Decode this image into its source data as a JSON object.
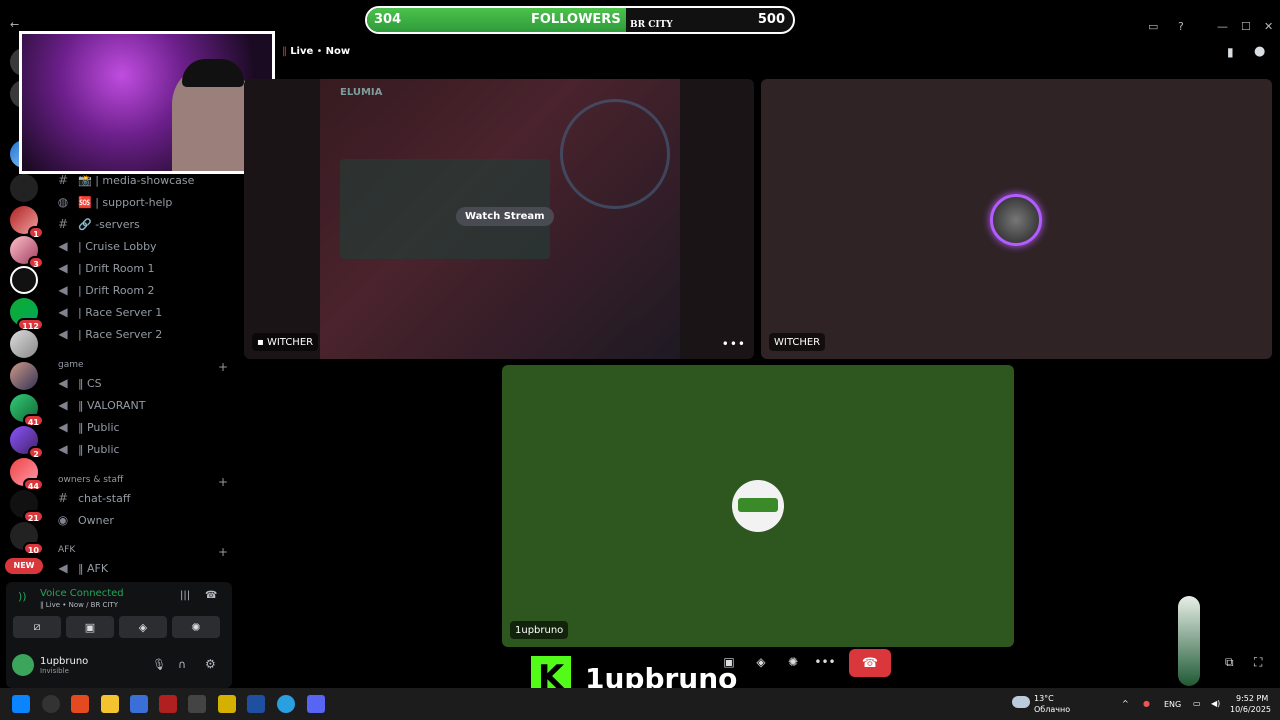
{
  "overlay": {
    "followers_current": "304",
    "followers_label": "FOLLOWERS",
    "followers_goal": "500",
    "followers_progress_fraction": 0.608,
    "server_tag": "BR CITY"
  },
  "stream_header": {
    "live_text": "Live",
    "separator": "•",
    "time": "Now"
  },
  "channels": [
    {
      "icon": "#",
      "emoji": "📸",
      "name": "| media-showcase"
    },
    {
      "icon": "help-icon",
      "emoji": "🆘",
      "name": "| support-help"
    },
    {
      "icon": "#",
      "emoji": "🔗",
      "name": "-servers"
    },
    {
      "icon": "speaker-icon",
      "emoji": "",
      "name": "| Cruise Lobby"
    },
    {
      "icon": "speaker-icon",
      "emoji": "",
      "name": "| Drift Room 1"
    },
    {
      "icon": "speaker-icon",
      "emoji": "",
      "name": "| Drift Room 2"
    },
    {
      "icon": "speaker-icon",
      "emoji": "",
      "name": "| Race Server 1"
    },
    {
      "icon": "speaker-icon",
      "emoji": "",
      "name": "| Race Server 2"
    }
  ],
  "categories": {
    "game": "game",
    "owners": "owners & staff",
    "afk": "AFK"
  },
  "game_channels": [
    "‖ CS",
    "‖ VALORANT",
    "‖ Public",
    "‖ Public"
  ],
  "owner_channels": [
    "chat-staff",
    "Owner"
  ],
  "afk_channels": [
    "‖ AFK"
  ],
  "server_badges": [
    "1",
    "3",
    "112",
    "41",
    "2",
    "44",
    "21",
    "10"
  ],
  "new_label": "NEW",
  "voice": {
    "status": "Voice Connected",
    "sub": "‖ Live • Now / BR CITY"
  },
  "user": {
    "name": "1upbruno",
    "status": "Invisible"
  },
  "tiles": {
    "tile1_label": "WITCHER",
    "watch_stream": "Watch Stream",
    "tile2_label": "WITCHER",
    "tile3_label": "1upbruno",
    "game_logo": "ELUMIA"
  },
  "kick": {
    "logo": "K",
    "name": "1upbruno"
  },
  "taskbar": {
    "weather_temp": "13°C",
    "weather_desc": "Облачно",
    "lang": "ENG",
    "time": "9:52 PM",
    "date": "10/6/2025"
  },
  "colors": {
    "followers_bar": "#4cc24c",
    "hangup": "#da373c",
    "voice_connected": "#23a55a",
    "tile3_bg": "#2e5720",
    "kick_green": "#53fc18"
  }
}
